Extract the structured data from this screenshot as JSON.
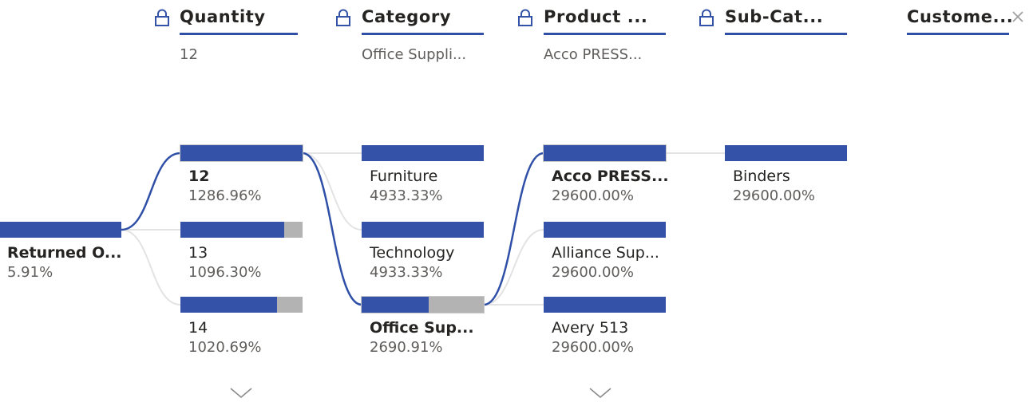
{
  "headers": [
    {
      "title": "Quantity",
      "value": "12",
      "locked": true
    },
    {
      "title": "Category",
      "value": "Office Suppli...",
      "locked": true
    },
    {
      "title": "Product ...",
      "value": "Acco PRESS...",
      "locked": true
    },
    {
      "title": "Sub-Cat...",
      "value": "",
      "locked": true
    },
    {
      "title": "Custome...",
      "value": "",
      "locked": false
    }
  ],
  "root": {
    "label": "Returned O...",
    "value": "5.91%"
  },
  "quantity_nodes": [
    {
      "label": "12",
      "value": "1286.96%",
      "fill": 1.0,
      "selected": true
    },
    {
      "label": "13",
      "value": "1096.30%",
      "fill": 0.85
    },
    {
      "label": "14",
      "value": "1020.69%",
      "fill": 0.79
    }
  ],
  "category_nodes": [
    {
      "label": "Furniture",
      "value": "4933.33%",
      "fill": 1.0
    },
    {
      "label": "Technology",
      "value": "4933.33%",
      "fill": 1.0
    },
    {
      "label": "Office Sup...",
      "value": "2690.91%",
      "fill": 0.55,
      "selected": true
    }
  ],
  "product_nodes": [
    {
      "label": "Acco PRESS...",
      "value": "29600.00%",
      "fill": 1.0,
      "selected": true
    },
    {
      "label": "Alliance Sup...",
      "value": "29600.00%",
      "fill": 1.0
    },
    {
      "label": "Avery 513",
      "value": "29600.00%",
      "fill": 1.0
    }
  ],
  "subcategory_nodes": [
    {
      "label": "Binders",
      "value": "29600.00%",
      "fill": 1.0
    }
  ],
  "colors": {
    "bar": "#3452a8",
    "remainder": "#b3b3b3",
    "path": "#3050a8",
    "link": "#e1e1e1"
  }
}
